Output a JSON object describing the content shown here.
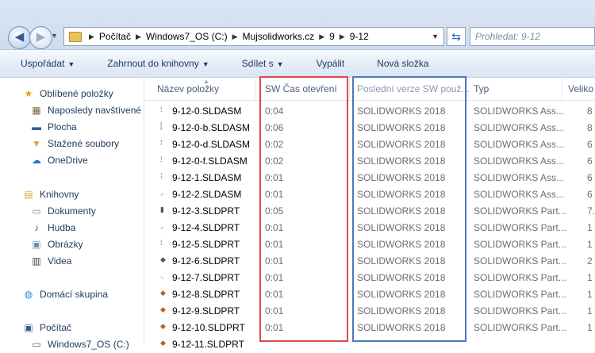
{
  "address": {
    "crumbs": [
      "Počítač",
      "Windows7_OS (C:)",
      "Mujsolidworks.cz",
      "9",
      "9-12"
    ],
    "search_placeholder": "Prohledat: 9-12"
  },
  "toolbar": {
    "organize": "Uspořádat",
    "include_library": "Zahrnout do knihovny",
    "share": "Sdílet s",
    "burn": "Vypálit",
    "new_folder": "Nová složka"
  },
  "sidebar": {
    "favorites": "Oblíbené položky",
    "recent": "Naposledy navštívené",
    "desktop": "Plocha",
    "downloads": "Stažené soubory",
    "onedrive": "OneDrive",
    "libraries": "Knihovny",
    "documents": "Dokumenty",
    "music": "Hudba",
    "pictures": "Obrázky",
    "videos": "Videa",
    "homegroup": "Domácí skupina",
    "computer": "Počítač",
    "drive": "Windows7_OS (C:)"
  },
  "columns": {
    "name": "Název položky",
    "time": "SW Čas otevření",
    "version": "Poslední verze SW použ...",
    "type": "Typ",
    "size": "Veliko"
  },
  "files": [
    {
      "name": "9-12-0.SLDASM",
      "time": "0:04",
      "version": "SOLIDWORKS 2018",
      "type": "SOLIDWORKS Ass...",
      "size": "8"
    },
    {
      "name": "9-12-0-b.SLDASM",
      "time": "0:06",
      "version": "SOLIDWORKS 2018",
      "type": "SOLIDWORKS Ass...",
      "size": "8"
    },
    {
      "name": "9-12-0-d.SLDASM",
      "time": "0:02",
      "version": "SOLIDWORKS 2018",
      "type": "SOLIDWORKS Ass...",
      "size": "6"
    },
    {
      "name": "9-12-0-f.SLDASM",
      "time": "0:02",
      "version": "SOLIDWORKS 2018",
      "type": "SOLIDWORKS Ass...",
      "size": "6"
    },
    {
      "name": "9-12-1.SLDASM",
      "time": "0:01",
      "version": "SOLIDWORKS 2018",
      "type": "SOLIDWORKS Ass...",
      "size": "6"
    },
    {
      "name": "9-12-2.SLDASM",
      "time": "0:01",
      "version": "SOLIDWORKS 2018",
      "type": "SOLIDWORKS Ass...",
      "size": "6"
    },
    {
      "name": "9-12-3.SLDPRT",
      "time": "0:05",
      "version": "SOLIDWORKS 2018",
      "type": "SOLIDWORKS Part...",
      "size": "7."
    },
    {
      "name": "9-12-4.SLDPRT",
      "time": "0:01",
      "version": "SOLIDWORKS 2018",
      "type": "SOLIDWORKS Part...",
      "size": "1"
    },
    {
      "name": "9-12-5.SLDPRT",
      "time": "0:01",
      "version": "SOLIDWORKS 2018",
      "type": "SOLIDWORKS Part...",
      "size": "1"
    },
    {
      "name": "9-12-6.SLDPRT",
      "time": "0:01",
      "version": "SOLIDWORKS 2018",
      "type": "SOLIDWORKS Part...",
      "size": "2"
    },
    {
      "name": "9-12-7.SLDPRT",
      "time": "0:01",
      "version": "SOLIDWORKS 2018",
      "type": "SOLIDWORKS Part...",
      "size": "1"
    },
    {
      "name": "9-12-8.SLDPRT",
      "time": "0:01",
      "version": "SOLIDWORKS 2018",
      "type": "SOLIDWORKS Part...",
      "size": "1"
    },
    {
      "name": "9-12-9.SLDPRT",
      "time": "0:01",
      "version": "SOLIDWORKS 2018",
      "type": "SOLIDWORKS Part...",
      "size": "1"
    },
    {
      "name": "9-12-10.SLDPRT",
      "time": "0:01",
      "version": "SOLIDWORKS 2018",
      "type": "SOLIDWORKS Part...",
      "size": "1"
    },
    {
      "name": "9-12-11.SLDPRT",
      "time": "",
      "version": "",
      "type": "",
      "size": ""
    }
  ],
  "colors": {
    "highlight_time": "#e0474b",
    "highlight_version": "#4c78c0"
  }
}
